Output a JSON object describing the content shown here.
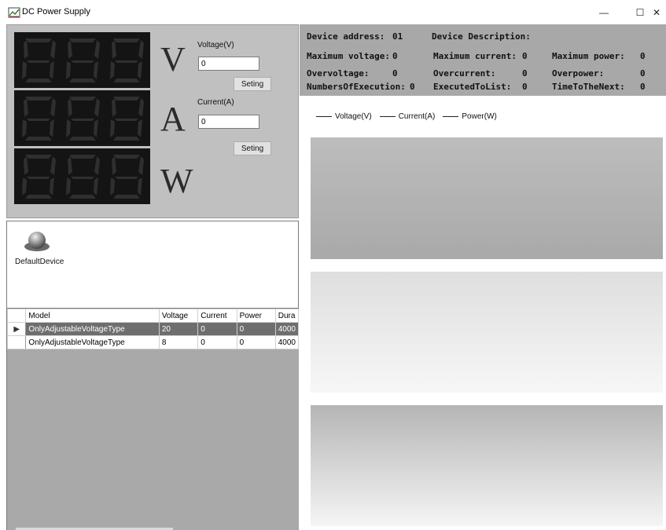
{
  "window": {
    "title": "DC Power Supply",
    "min_glyph": "—",
    "max_glyph": "☐",
    "close_glyph": "✕"
  },
  "display": {
    "voltage_unit": "V",
    "current_unit": "A",
    "power_unit": "W",
    "voltage_label": "Voltage(V)",
    "voltage_value": "0",
    "voltage_button": "Seting",
    "current_label": "Current(A)",
    "current_value": "0",
    "current_button": "Seting"
  },
  "device": {
    "name": "DefaultDevice"
  },
  "grid": {
    "columns": [
      "Model",
      "Voltage",
      "Current",
      "Power",
      "Dura"
    ],
    "rows": [
      {
        "model": "OnlyAdjustableVoltageType",
        "voltage": "20",
        "current": "0",
        "power": "0",
        "duration": "4000"
      },
      {
        "model": "OnlyAdjustableVoltageType",
        "voltage": "8",
        "current": "0",
        "power": "0",
        "duration": "4000"
      }
    ],
    "selected_marker": "▶"
  },
  "info": {
    "device_address_label": "Device address:",
    "device_address_value": "01",
    "device_description_label": "Device Description:",
    "max_voltage_label": "Maximum voltage:",
    "max_voltage_value": "0",
    "max_current_label": "Maximum current:",
    "max_current_value": "0",
    "max_power_label": "Maximum power:",
    "max_power_value": "0",
    "overvoltage_label": "Overvoltage:",
    "overvoltage_value": "0",
    "overcurrent_label": "Overcurrent:",
    "overcurrent_value": "0",
    "overpower_label": "Overpower:",
    "overpower_value": "0",
    "executions_label": "NumbersOfExecution:",
    "executions_value": "0",
    "executed_label": "ExecutedToList:",
    "executed_value": "0",
    "time_next_label": "TimeToTheNext:",
    "time_next_value": "0"
  },
  "legend": {
    "voltage": "Voltage(V)",
    "current": "Current(A)",
    "power": "Power(W)"
  }
}
